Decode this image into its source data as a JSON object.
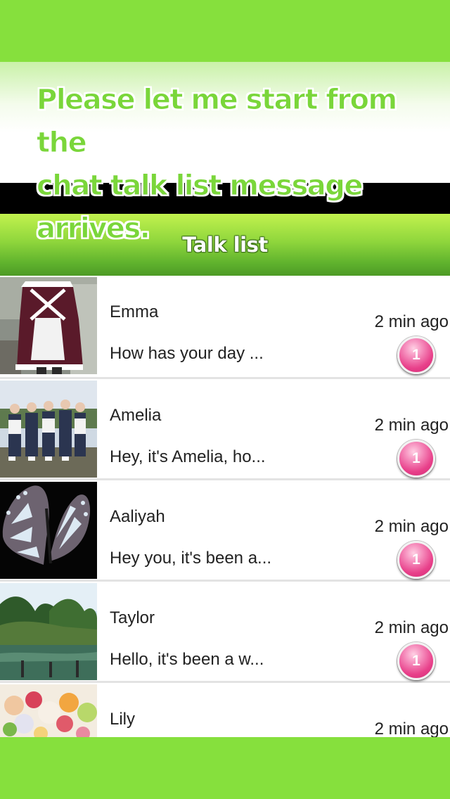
{
  "promo": {
    "line1": "Please let me start from the",
    "line2": "chat talk list message",
    "line3": "arrives."
  },
  "header": {
    "title": "Talk list"
  },
  "colors": {
    "brand_green": "#86e03d",
    "headline_green": "#7ad63a",
    "badge_pink": "#e8408a"
  },
  "conversations": [
    {
      "name": "Emma",
      "preview": "How has your day ...",
      "time": "2 min ago",
      "unread": "1",
      "photo": "maid-costume-photo"
    },
    {
      "name": "Amelia",
      "preview": "Hey, it's Amelia, ho...",
      "time": "2 min ago",
      "unread": "1",
      "photo": "group-of-girls-photo"
    },
    {
      "name": "Aaliyah",
      "preview": "Hey you, it's been a...",
      "time": "2 min ago",
      "unread": "1",
      "photo": "butterfly-photo"
    },
    {
      "name": "Taylor",
      "preview": "Hello, it's been a w...",
      "time": "2 min ago",
      "unread": "1",
      "photo": "pond-landscape-photo"
    },
    {
      "name": "Lily",
      "preview": "",
      "time": "2 min ago",
      "unread": "",
      "photo": "sweets-photo"
    }
  ]
}
